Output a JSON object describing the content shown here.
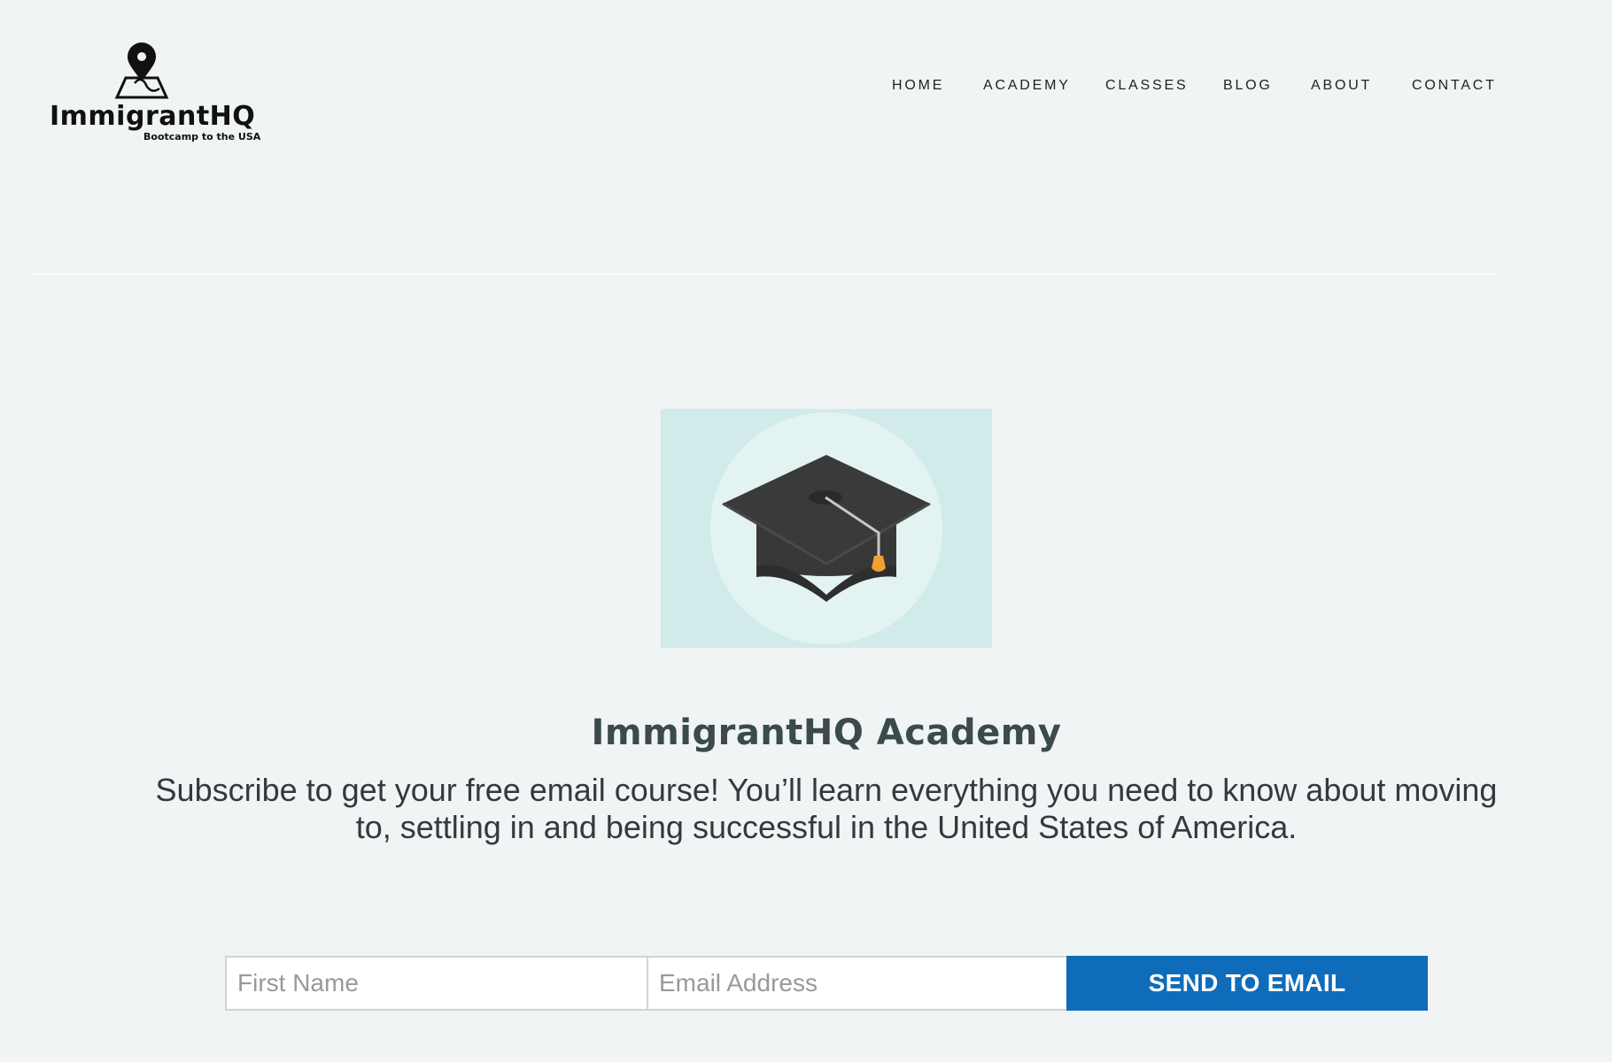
{
  "brand": {
    "name": "ImmigrantHQ",
    "tagline": "Bootcamp to the USA"
  },
  "nav": {
    "items": [
      {
        "label": "HOME"
      },
      {
        "label": "ACADEMY"
      },
      {
        "label": "CLASSES"
      },
      {
        "label": "BLOG"
      },
      {
        "label": "ABOUT"
      },
      {
        "label": "CONTACT"
      }
    ]
  },
  "hero": {
    "image_icon": "graduation-cap-icon",
    "title": "ImmigrantHQ Academy",
    "subtitle": "Subscribe to get your free email course! You’ll learn everything you need to know about moving to, settling in and being successful in the United States of America."
  },
  "form": {
    "first_name_placeholder": "First Name",
    "first_name_value": "",
    "email_placeholder": "Email Address",
    "email_value": "",
    "submit_label": "SEND TO EMAIL"
  },
  "colors": {
    "background": "#f0f4f4",
    "accent": "#0f6cbb",
    "hero_tile": "#d1ebea",
    "tassel": "#f0a030"
  }
}
